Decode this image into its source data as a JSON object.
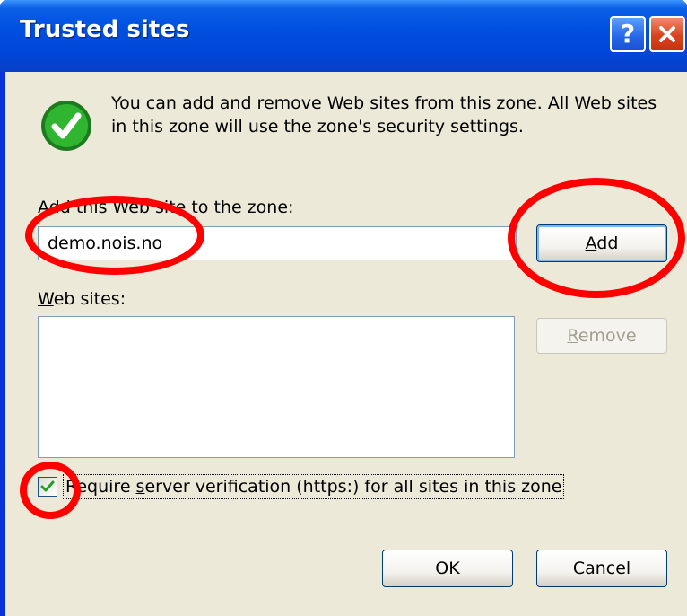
{
  "window": {
    "title": "Trusted sites",
    "help_label": "?",
    "close_icon": "close-icon"
  },
  "info": {
    "icon": "checkmark-icon",
    "text": "You can add and remove Web sites from this zone. All Web sites in this zone will use the zone's security settings."
  },
  "add_site": {
    "label": "Add this Web site to the zone:",
    "input_value": "demo.nois.no",
    "add_button": {
      "mnemonic": "A",
      "rest": "dd"
    }
  },
  "web_sites": {
    "label_mnemonic": "W",
    "label_rest": "eb sites:",
    "items": [],
    "remove_button": {
      "mnemonic": "R",
      "rest": "emove"
    }
  },
  "verification": {
    "checked": true,
    "label_before": "Require ",
    "label_mnemonic": "s",
    "label_after": "erver verification (https:) for all sites in this zone"
  },
  "footer": {
    "ok_label": "OK",
    "cancel_label": "Cancel"
  },
  "colors": {
    "title_bar": "#0050e0",
    "dialog_face": "#ece9d8",
    "annotation": "#ff0000",
    "check_green": "#21a121"
  }
}
